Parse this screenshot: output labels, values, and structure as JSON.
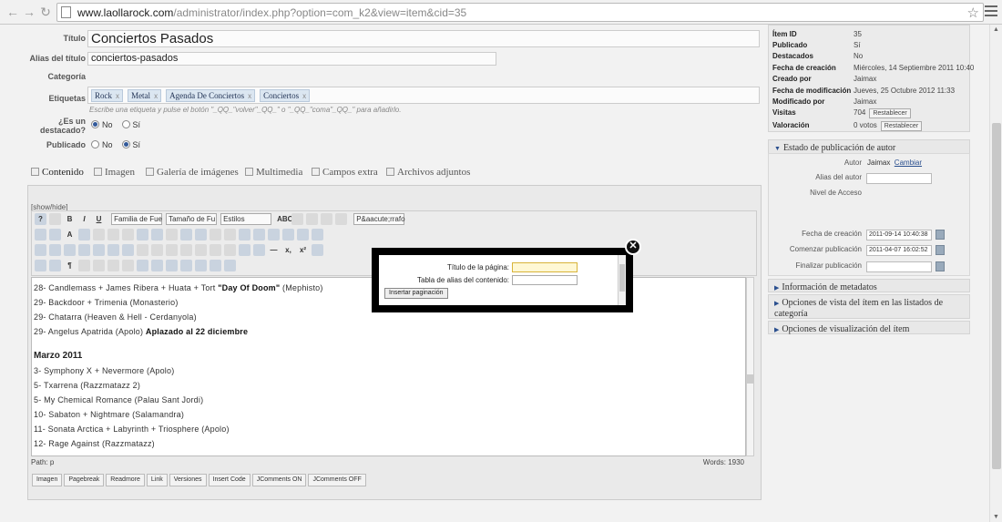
{
  "browser": {
    "url_host": "www.laollarock.com",
    "url_path": "/administrator/index.php?option=com_k2&view=item&cid=35"
  },
  "form": {
    "title_label": "Título",
    "title_value": "Conciertos Pasados",
    "alias_label": "Alias del título",
    "alias_value": "conciertos-pasados",
    "category_label": "Categoría",
    "tags_label": "Etiquetas",
    "tags": [
      "Rock",
      "Metal",
      "Agenda De Conciertos",
      "Conciertos"
    ],
    "tag_remove": "x",
    "tags_hint": "Escribe una etiqueta y pulse el botón \"_QQ_\"volver\"_QQ_\" o \"_QQ_\"coma\"_QQ_\" para añadirlo.",
    "featured_label_1": "¿Es un",
    "featured_label_2": "destacado?",
    "featured_no": "No",
    "featured_yes": "Sí",
    "published_label": "Publicado",
    "published_no": "No",
    "published_yes": "Sí"
  },
  "tabs": [
    "Contenido",
    "Imagen",
    "Galería de imágenes",
    "Multimedia",
    "Campos extra",
    "Archivos adjuntos"
  ],
  "editor": {
    "showhide": "[show/hide]",
    "font_family": "Familia de Fue",
    "font_size": "Tamaño de Fu",
    "styles": "Estilos",
    "paragraph": "P&aacute;rrafo",
    "content": [
      {
        "text": "28- Candlemass + James Ribera + Huata + Tort ",
        "bold": "\"Day Of Doom\"",
        "after": " (Mephisto)"
      },
      {
        "text": "29- Backdoor + Trimenia (Monasterio)"
      },
      {
        "text": "29- Chatarra (Heaven & Hell - Cerdanyola)"
      },
      {
        "text": "29- Angelus Apatrida (Apolo) ",
        "bold": "Aplazado al 22 diciembre"
      }
    ],
    "month_heading": "Marzo 2011",
    "content2": [
      "3- Symphony X + Nevermore (Apolo)",
      "5- Txarrena (Razzmatazz 2)",
      "5- My Chemical Romance (Palau Sant Jordi)",
      "10- Sabaton + Nightmare (Salamandra)",
      "11- Sonata Arctica + Labyrinth + Triosphere (Apolo)",
      "12- Rage Against (Razzmatazz)"
    ],
    "path": "Path: p",
    "words": "Words: 1930",
    "buttons": [
      "Imagen",
      "Pagebreak",
      "Readmore",
      "Link",
      "Versiones",
      "Insert Code",
      "JComments ON",
      "JComments OFF"
    ]
  },
  "info": {
    "rows": [
      {
        "k": "Ítem ID",
        "v": "35"
      },
      {
        "k": "Publicado",
        "v": "Sí"
      },
      {
        "k": "Destacados",
        "v": "No"
      },
      {
        "k": "Fecha de creación",
        "v": "Miércoles, 14 Septiembre 2011 10:40"
      },
      {
        "k": "Creado por",
        "v": "Jaimax"
      },
      {
        "k": "Fecha de modificación",
        "v": "Jueves, 25 Octubre 2012 11:33"
      },
      {
        "k": "Modificado por",
        "v": "Jaimax"
      },
      {
        "k": "Visitas",
        "v": "704"
      },
      {
        "k": "Valoración",
        "v": "0 votos"
      }
    ],
    "reset_label": "Restablecer"
  },
  "author_panel": {
    "title": "Estado de publicación de autor",
    "author_label": "Autor",
    "author_value": "Jaimax",
    "change_link": "Cambiar",
    "alias_label": "Alias del autor",
    "access_label": "Nivel de Acceso",
    "created_label": "Fecha de creación",
    "created_value": "2011-09-14 10:40:38",
    "publish_start_label": "Comenzar publicación",
    "publish_start_value": "2011-04-07 16:02:52",
    "publish_end_label": "Finalizar publicación"
  },
  "accordions": [
    "Información de metadatos",
    "Opciones de vista del ítem en las listados de categoría",
    "Opciones de visualización del ítem"
  ],
  "modal": {
    "page_title_label": "Título de la página:",
    "alias_table_label": "Tabla de alias del contenido:",
    "insert_button": "Insertar paginación",
    "close_symbol": "✕"
  }
}
